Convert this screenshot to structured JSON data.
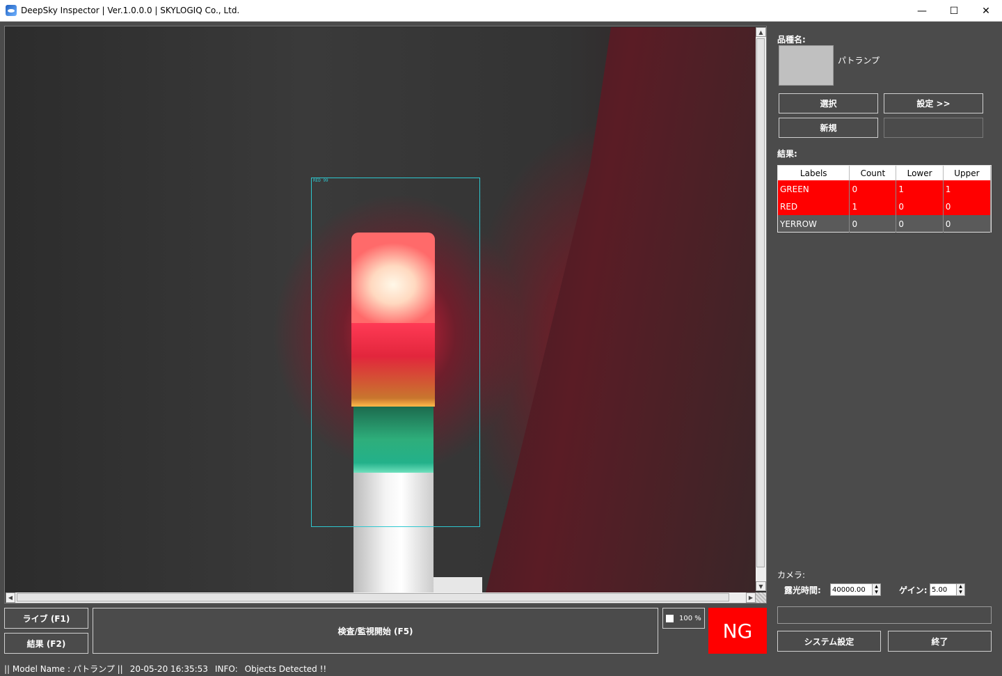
{
  "window": {
    "title": "DeepSky Inspector | Ver.1.0.0.0 | SKYLOGIQ Co., Ltd.",
    "minimize_glyph": "—",
    "maximize_glyph": "☐",
    "close_glyph": "✕"
  },
  "viewport": {
    "detection_label": "RED 99"
  },
  "model": {
    "section_label": "品種名:",
    "name": "パトランプ",
    "select_label": "選択",
    "settings_label": "設定 >>",
    "new_label": "新規"
  },
  "results": {
    "section_label": "結果:",
    "columns": [
      "Labels",
      "Count",
      "Lower",
      "Upper"
    ],
    "rows": [
      {
        "label": "GREEN",
        "count": "0",
        "lower": "1",
        "upper": "1",
        "status": "ng"
      },
      {
        "label": "RED",
        "count": "1",
        "lower": "0",
        "upper": "0",
        "status": "ng"
      },
      {
        "label": "YERROW",
        "count": "0",
        "lower": "0",
        "upper": "0",
        "status": "ok"
      }
    ],
    "ng_color": "#ff0000"
  },
  "camera": {
    "section_label": "カメラ:",
    "exposure_label": "露光時間:",
    "exposure_value": "40000.00",
    "gain_label": "ゲイン:",
    "gain_value": "5.00"
  },
  "controls": {
    "live_label": "ライブ (F1)",
    "results_label": "結果 (F2)",
    "inspect_label": "検査/監視開始 (F5)",
    "zoom_label": "100 %",
    "judgement": "NG",
    "system_settings_label": "システム設定",
    "exit_label": "終了"
  },
  "status": {
    "model": "|| Model Name : パトランプ ||",
    "timestamp": "20-05-20 16:35:53",
    "info_label": "INFO:",
    "message": "Objects Detected !!"
  },
  "icons": [
    "app-icon",
    "scroll-up-icon",
    "scroll-down-icon",
    "scroll-left-icon",
    "scroll-right-icon"
  ]
}
